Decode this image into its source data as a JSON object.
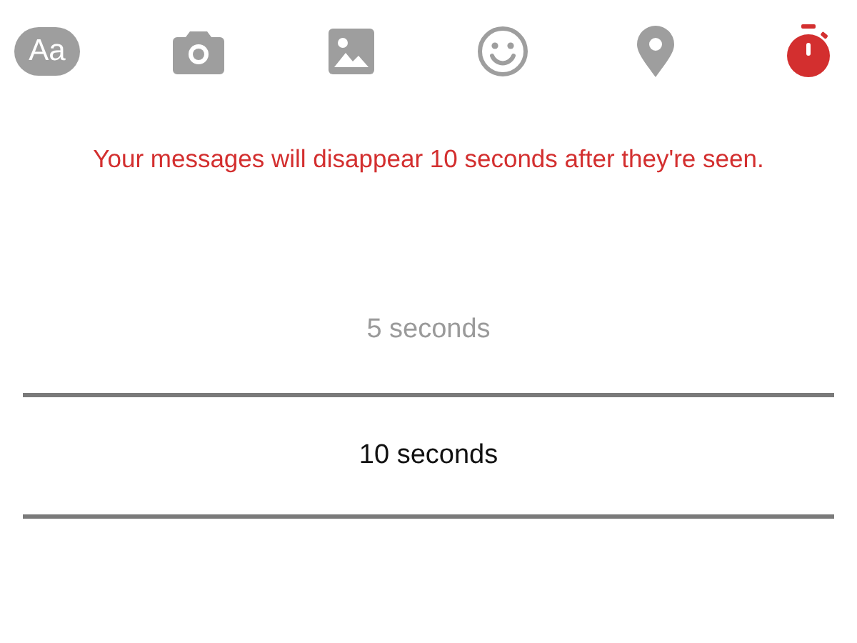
{
  "toolbar": [
    {
      "kind": "text",
      "label": "Aa",
      "selected": false
    },
    {
      "kind": "camera",
      "selected": false
    },
    {
      "kind": "image",
      "selected": false
    },
    {
      "kind": "emoji",
      "selected": false
    },
    {
      "kind": "location",
      "selected": false
    },
    {
      "kind": "timer",
      "selected": true
    }
  ],
  "notice": "Your messages will disappear 10 seconds after they're seen.",
  "picker": [
    {
      "label": "5 seconds",
      "selected": false
    },
    {
      "label": "10 seconds",
      "selected": true
    }
  ]
}
